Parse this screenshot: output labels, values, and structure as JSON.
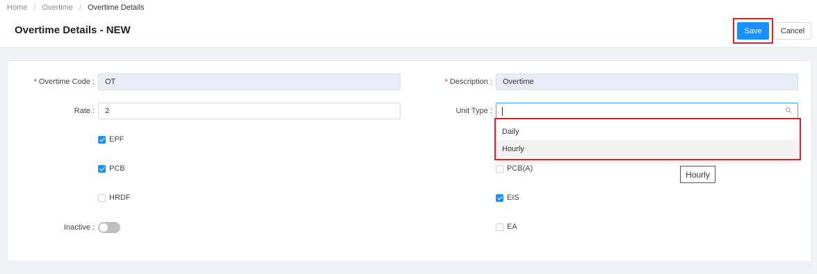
{
  "breadcrumb": {
    "home": "Home",
    "overtime": "Overtime",
    "current": "Overtime Details",
    "separator": "/"
  },
  "page_title": "Overtime Details - NEW",
  "toolbar": {
    "save_label": "Save",
    "cancel_label": "Cancel"
  },
  "form": {
    "overtime_code": {
      "label": "Overtime Code :",
      "required_mark": "*",
      "value": "OT"
    },
    "description": {
      "label": "Description :",
      "required_mark": "*",
      "value": "Overtime"
    },
    "rate": {
      "label": "Rate :",
      "value": "2"
    },
    "unit_type": {
      "label": "Unit Type :",
      "value": ""
    },
    "checkboxes": {
      "epf": {
        "label": "EPF",
        "checked": true
      },
      "pcb": {
        "label": "PCB",
        "checked": true
      },
      "hrdf": {
        "label": "HRDF",
        "checked": false
      },
      "pcb_a": {
        "label": "PCB(A)",
        "checked": false
      },
      "eis": {
        "label": "EIS",
        "checked": true
      },
      "ea": {
        "label": "EA",
        "checked": false
      }
    },
    "inactive": {
      "label": "Inactive :",
      "on": false
    }
  },
  "unit_type_dropdown": {
    "options": [
      "Daily",
      "Hourly"
    ],
    "hovered": "Hourly"
  },
  "tooltip": "Hourly",
  "colors": {
    "primary": "#1890ff",
    "highlight": "#e31e24",
    "disabled_input": "#e8eef8"
  }
}
